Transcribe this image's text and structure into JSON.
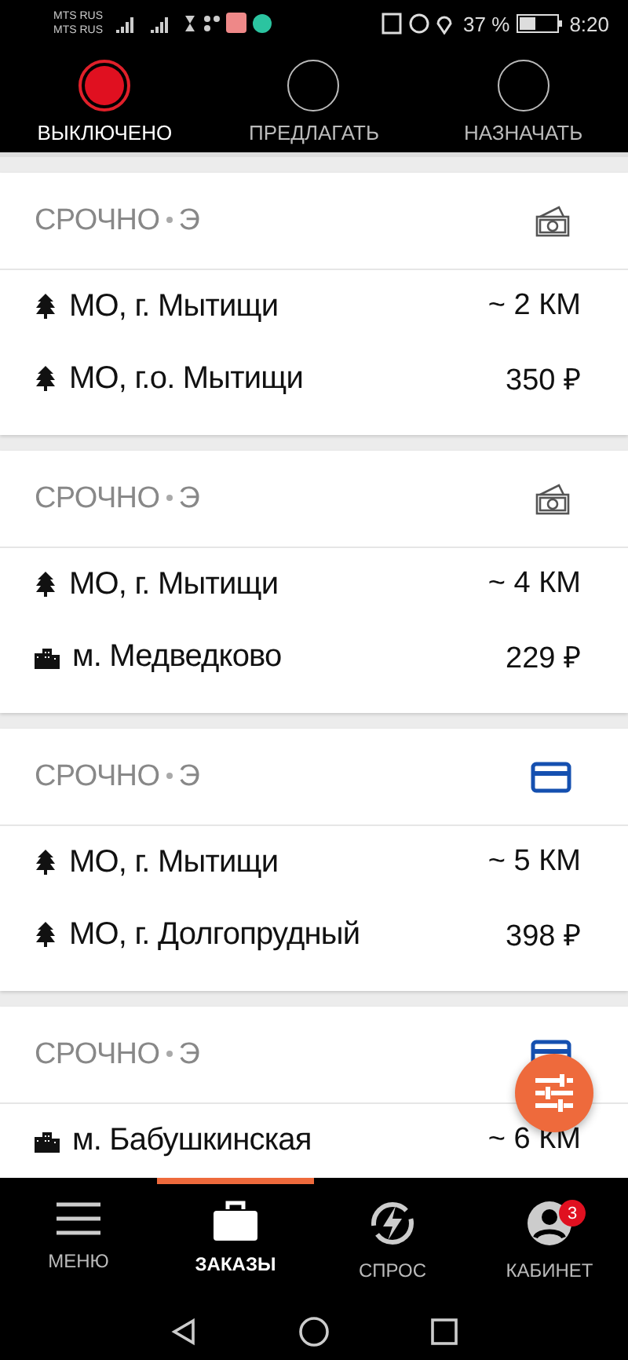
{
  "status_bar": {
    "carriers": [
      "MTS RUS",
      "MTS RUS"
    ],
    "battery": "37 %",
    "time": "8:20"
  },
  "modes": [
    {
      "label": "ВЫКЛЮЧЕНО",
      "selected": true
    },
    {
      "label": "ПРЕДЛАГАТЬ",
      "selected": false
    },
    {
      "label": "НАЗНАЧАТЬ",
      "selected": false
    }
  ],
  "orders": [
    {
      "title": "СРОЧНО",
      "tag": "Э",
      "payment": {
        "kind": "cash"
      },
      "from": {
        "kind": "tree",
        "place": "МО, г. Мытищи"
      },
      "to": {
        "kind": "tree",
        "place": "МО, г.о. Мытищи"
      },
      "distance": "~ 2 КМ",
      "price": "350 ₽"
    },
    {
      "title": "СРОЧНО",
      "tag": "Э",
      "payment": {
        "kind": "cash"
      },
      "from": {
        "kind": "tree",
        "place": "МО, г. Мытищи"
      },
      "to": {
        "kind": "city",
        "place": "м. Медведково"
      },
      "distance": "~ 4 КМ",
      "price": "229 ₽"
    },
    {
      "title": "СРОЧНО",
      "tag": "Э",
      "payment": {
        "kind": "card"
      },
      "from": {
        "kind": "tree",
        "place": "МО, г. Мытищи"
      },
      "to": {
        "kind": "tree",
        "place": "МО, г. Долгопрудный"
      },
      "distance": "~ 5 КМ",
      "price": "398 ₽"
    },
    {
      "title": "СРОЧНО",
      "tag": "Э",
      "payment": {
        "kind": "card"
      },
      "from": {
        "kind": "city",
        "place": "м. Бабушкинская"
      },
      "distance": "~ 6 КМ"
    }
  ],
  "nav": [
    {
      "kind": "menu",
      "label": "МЕНЮ",
      "selected": false
    },
    {
      "kind": "orders",
      "label": "ЗАКАЗЫ",
      "selected": true
    },
    {
      "kind": "demand",
      "label": "СПРОС",
      "selected": false
    },
    {
      "kind": "cabinet",
      "label": "КАБИНЕТ",
      "selected": false,
      "badge": "3"
    }
  ]
}
